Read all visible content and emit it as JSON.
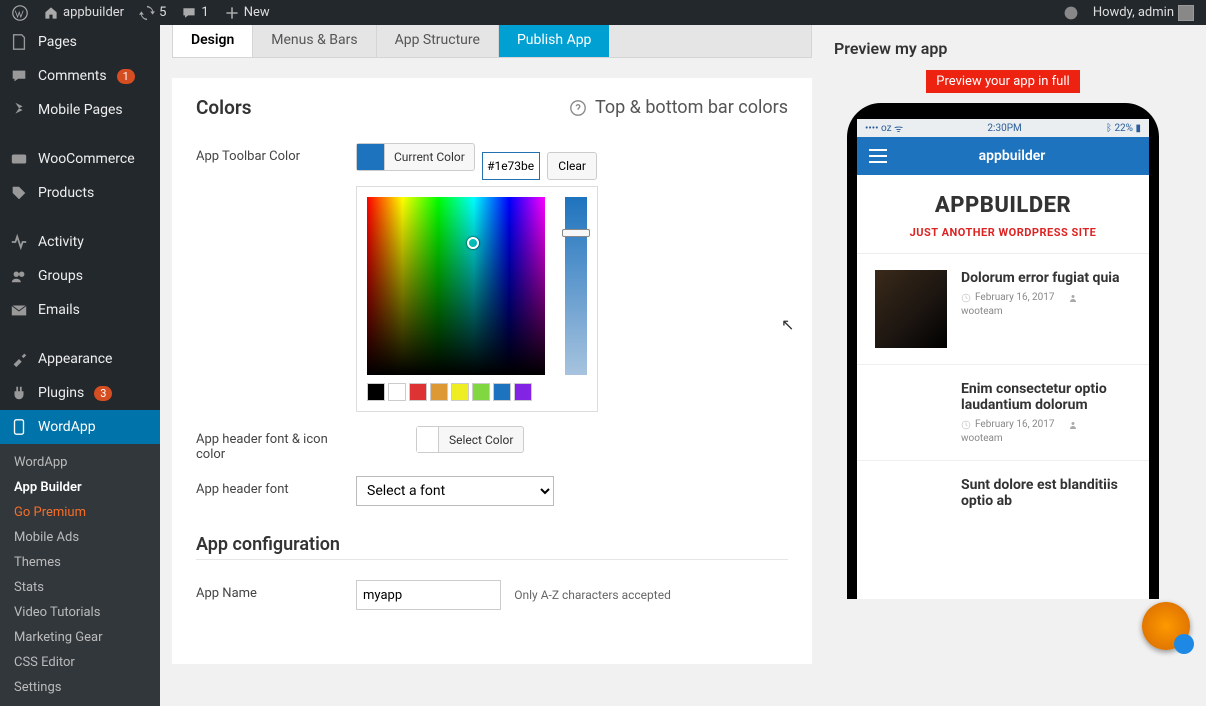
{
  "adminbar": {
    "site": "appbuilder",
    "updates": "5",
    "comments": "1",
    "new": "New",
    "howdy": "Howdy, admin"
  },
  "sidebar": {
    "items": [
      {
        "label": "Pages"
      },
      {
        "label": "Comments",
        "badge": "1"
      },
      {
        "label": "Mobile Pages"
      },
      {
        "label": "WooCommerce"
      },
      {
        "label": "Products"
      },
      {
        "label": "Activity"
      },
      {
        "label": "Groups"
      },
      {
        "label": "Emails"
      },
      {
        "label": "Appearance"
      },
      {
        "label": "Plugins",
        "badge": "3"
      },
      {
        "label": "WordApp"
      }
    ],
    "sub": [
      {
        "label": "WordApp"
      },
      {
        "label": "App Builder"
      },
      {
        "label": "Go Premium"
      },
      {
        "label": "Mobile Ads"
      },
      {
        "label": "Themes"
      },
      {
        "label": "Stats"
      },
      {
        "label": "Video Tutorials"
      },
      {
        "label": "Marketing Gear"
      },
      {
        "label": "CSS Editor"
      },
      {
        "label": "Settings"
      }
    ]
  },
  "tabs": {
    "design": "Design",
    "menus": "Menus & Bars",
    "struct": "App Structure",
    "publish": "Publish App"
  },
  "colors": {
    "heading": "Colors",
    "help": "Top & bottom bar colors",
    "toolbar_label": "App Toolbar Color",
    "current_btn": "Current Color",
    "hex": "#1e73be",
    "clear": "Clear",
    "palette": [
      "#000000",
      "#ffffff",
      "#dd3333",
      "#dd9933",
      "#eeee22",
      "#81d742",
      "#1e73be",
      "#8224e3"
    ],
    "header_font_label": "App header font & icon color",
    "select_color": "Select Color",
    "font_label": "App header font",
    "font_placeholder": "Select a font"
  },
  "config": {
    "heading": "App configuration",
    "name_label": "App Name",
    "name_value": "myapp",
    "name_hint": "Only A-Z characters accepted"
  },
  "preview": {
    "heading": "Preview my app",
    "full_link": "Preview your app in full",
    "status": {
      "carrier": "•••• oz",
      "time": "2:30PM",
      "batt": "22%"
    },
    "app_title": "appbuilder",
    "hero_title": "APPBUILDER",
    "hero_tag": "JUST ANOTHER WORDPRESS SITE",
    "posts": [
      {
        "title": "Dolorum error fugiat quia",
        "date": "February 16, 2017",
        "author": "wooteam"
      },
      {
        "title": "Enim consectetur optio laudantium dolorum",
        "date": "February 16, 2017",
        "author": "wooteam"
      },
      {
        "title": "Sunt dolore est blanditiis optio ab"
      }
    ]
  }
}
